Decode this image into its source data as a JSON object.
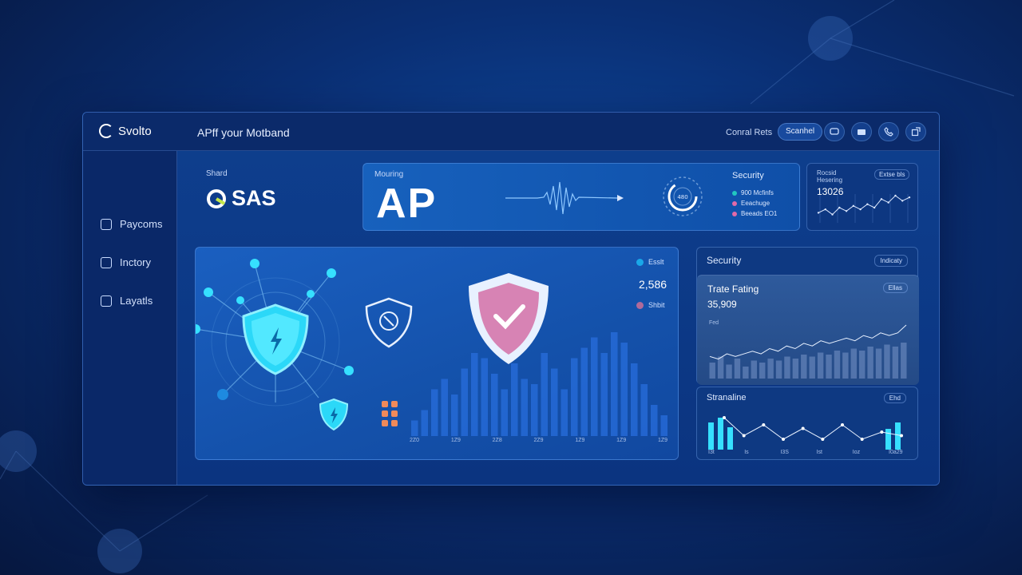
{
  "app": {
    "brand": "Svolto",
    "title": "APff your Motband"
  },
  "topbar": {
    "control_label": "Conral Rets",
    "scan_button": "Scanhel",
    "icons": [
      "chat-icon",
      "wallet-icon",
      "phone-icon",
      "external-icon"
    ]
  },
  "sidebar": {
    "items": [
      {
        "label": "Paycoms",
        "icon": "home-icon"
      },
      {
        "label": "Inctory",
        "icon": "inventory-icon"
      },
      {
        "label": "Layatls",
        "icon": "layers-icon"
      }
    ]
  },
  "brand_card": {
    "label": "Shard",
    "logo_text": "SAS"
  },
  "monitoring_card": {
    "label": "Mouring",
    "big_text": "AP",
    "security_label": "Security",
    "legend": [
      {
        "text": "900 Mcfinfs",
        "color": "#22c7c0"
      },
      {
        "text": "Eeachuge",
        "color": "#e06aa8"
      },
      {
        "text": "Beeads EO1",
        "color": "#e06aa8"
      }
    ],
    "gauge_text": "480"
  },
  "mini_card": {
    "label1": "Rocsid",
    "label2": "Hesering",
    "value": "13026",
    "badge": "Extse bls",
    "sparkline": [
      4,
      6,
      3,
      7,
      5,
      8,
      6,
      9,
      7,
      12,
      10,
      14,
      11,
      13
    ]
  },
  "main_panel": {
    "legend1": "Esslt",
    "value": "2,586",
    "legend2": "Shbit",
    "accent_colors": {
      "cyan": "#36e0ff",
      "pink": "#e07bb0",
      "orange": "#f08a5a"
    },
    "x_labels": [
      "2Z0",
      "1Z9",
      "2Z8",
      "2Z9",
      "1Z9",
      "1Z9",
      "1Z9"
    ],
    "bars": [
      3,
      5,
      9,
      11,
      8,
      13,
      16,
      15,
      12,
      9,
      14,
      11,
      10,
      16,
      13,
      9,
      15,
      17,
      19,
      16,
      20,
      18,
      14,
      10,
      6,
      4
    ]
  },
  "security_panel": {
    "title": "Security",
    "badge": "Indicaty",
    "sub_title": "Trate Fating",
    "sub_value": "35,909",
    "sub_badge": "Ellas",
    "sub_axis": "Fed",
    "bars": [
      8,
      11,
      7,
      10,
      6,
      9,
      8,
      10,
      9,
      11,
      10,
      12,
      11,
      13,
      12,
      14,
      13,
      15,
      14,
      16,
      15,
      17,
      16,
      18
    ],
    "line": [
      6,
      5,
      7,
      6,
      7,
      8,
      7,
      9,
      8,
      10,
      9,
      11,
      10,
      12,
      11,
      12,
      13,
      12,
      14,
      13,
      15,
      14,
      15,
      18
    ]
  },
  "stream_panel": {
    "title": "Stranaline",
    "badge": "Ehd",
    "x_labels": [
      "I3t",
      "Is",
      "I3S",
      "Ist",
      "Ioz",
      "I0a29"
    ],
    "line": [
      8,
      3,
      6,
      2,
      5,
      2,
      6,
      2,
      4,
      3
    ]
  }
}
